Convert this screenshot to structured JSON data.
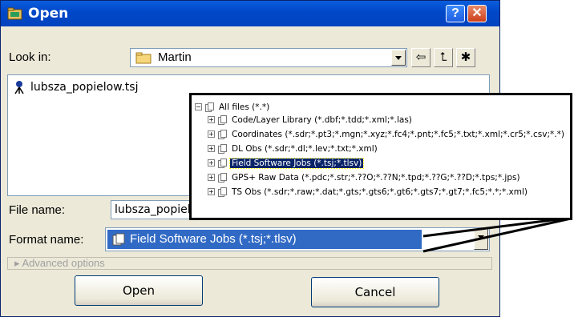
{
  "window": {
    "title": "Open",
    "help_glyph": "?",
    "close_glyph": "✕"
  },
  "look_in": {
    "label": "Look in:",
    "value": "Martin"
  },
  "toolbar": {
    "icons": [
      "back-icon",
      "up-folder-icon",
      "new-folder-icon"
    ]
  },
  "file_list": {
    "items": [
      {
        "name": "lubsza_popielow.tsj"
      }
    ]
  },
  "file_name": {
    "label": "File name:",
    "value": "lubsza_popielow.tsj"
  },
  "format_name": {
    "label": "Format name:",
    "value": "Field Software Jobs (*.tsj;*.tlsv)"
  },
  "advanced": {
    "label": "Advanced options"
  },
  "buttons": {
    "open": "Open",
    "cancel": "Cancel"
  },
  "format_popup": {
    "root": "All files (*.*)",
    "items": [
      "Code/Layer Library (*.dbf;*.tdd;*.xml;*.las)",
      "Coordinates (*.sdr;*.pt3;*.mgn;*.xyz;*.fc4;*.pnt;*.fc5;*.txt;*.xml;*.cr5;*.csv;*.*)",
      "DL Obs (*.sdr;*.dl;*.lev;*.txt;*.xml)",
      "Field Software Jobs (*.tsj;*.tlsv)",
      "GPS+ Raw Data (*.pdc;*.str;*.??O;*.??N;*.tpd;*.??G;*.??D;*.tps;*.jps)",
      "TS Obs (*.sdr;*.raw;*.dat;*.gts;*.gts6;*.gt6;*.gts7;*.gt7;*.fc5;*.*;*.xml)"
    ],
    "selected_index": 3
  },
  "colors": {
    "title_bar": "#0047c8",
    "dialog_bg": "#ece9d8",
    "selection": "#0a246a"
  }
}
